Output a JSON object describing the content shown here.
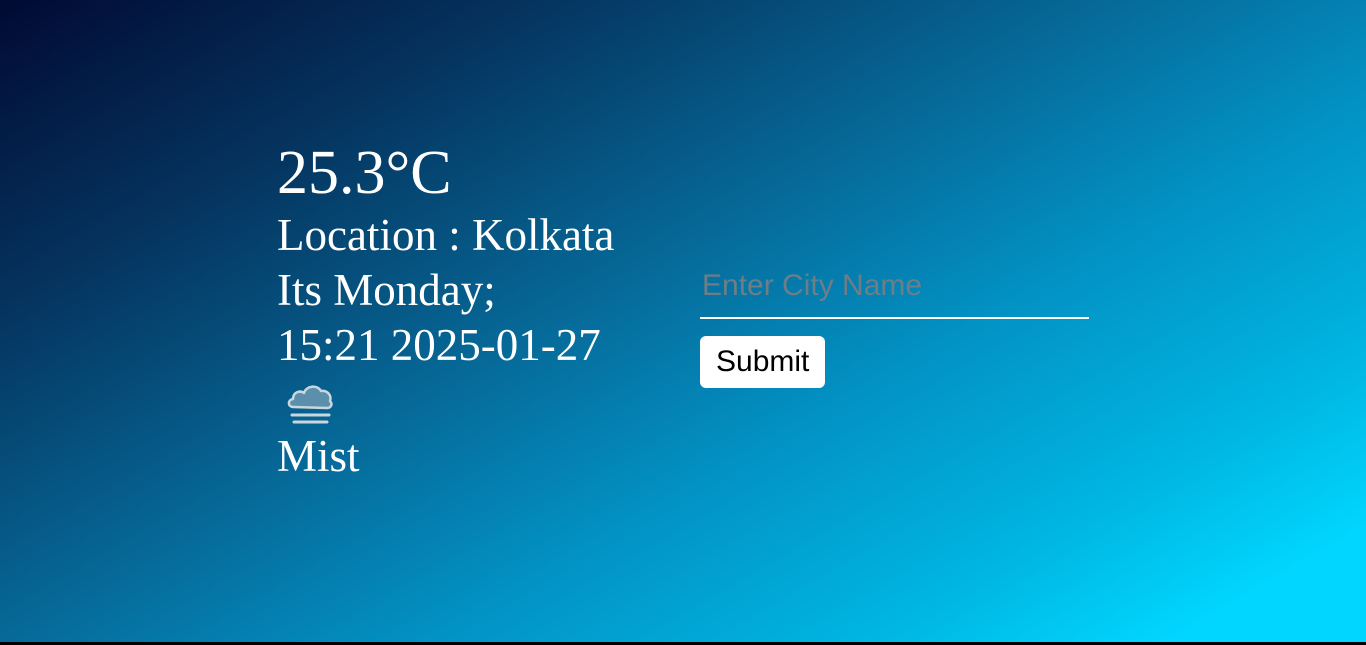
{
  "weather": {
    "temperature": "25.3°C",
    "location": "Location : Kolkata",
    "day": "Its Monday;",
    "datetime": "15:21 2025-01-27",
    "condition_icon": "mist-cloud-icon",
    "condition": "Mist"
  },
  "search": {
    "placeholder": "Enter City Name",
    "value": "",
    "submit_label": "Submit"
  },
  "colors": {
    "gradient_start": "#010a33",
    "gradient_end": "#00d6ff",
    "text": "#ffffff",
    "placeholder": "#6f7d86"
  }
}
